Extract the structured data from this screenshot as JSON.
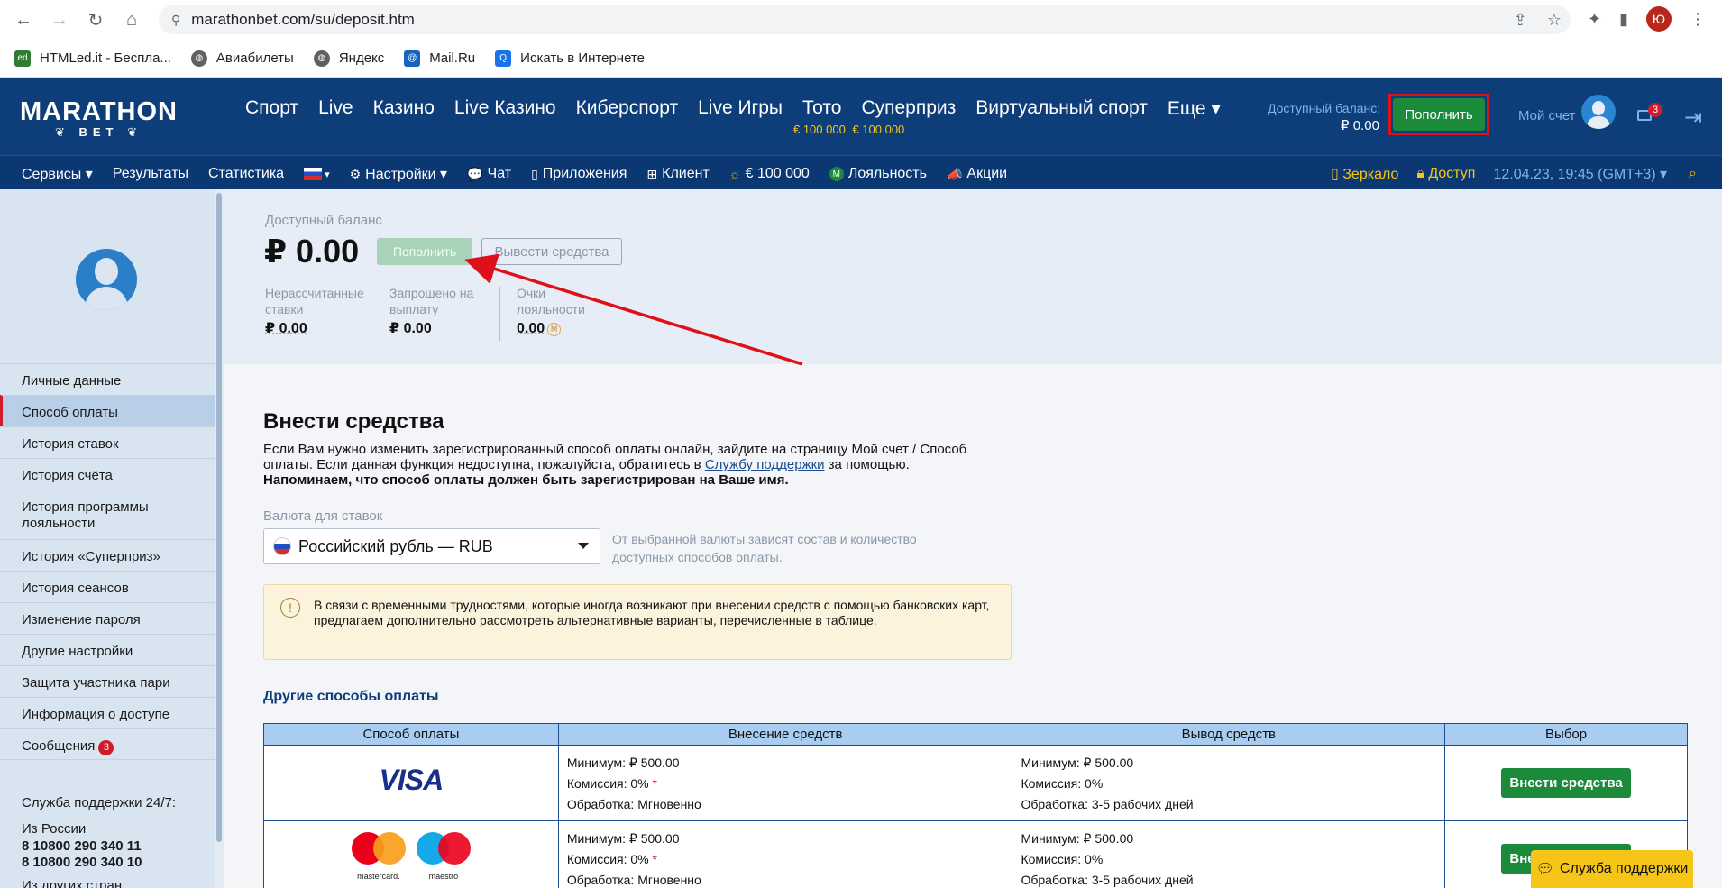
{
  "browser": {
    "url": "marathonbet.com/su/deposit.htm",
    "profile_initial": "Ю",
    "bookmarks": [
      {
        "label": "HTMLed.it - Беспла...",
        "color": "#2e7d32"
      },
      {
        "label": "Авиабилеты",
        "color": "#616161"
      },
      {
        "label": "Яндекс",
        "color": "#616161"
      },
      {
        "label": "Mail.Ru",
        "color": "#1565c0"
      },
      {
        "label": "Искать в Интернете",
        "color": "#1a73e8"
      }
    ]
  },
  "header": {
    "logo_line1": "MARATHON",
    "logo_line2": "BET",
    "nav": [
      {
        "label": "Спорт"
      },
      {
        "label": "Live"
      },
      {
        "label": "Казино"
      },
      {
        "label": "Live Казино"
      },
      {
        "label": "Киберспорт"
      },
      {
        "label": "Live Игры"
      },
      {
        "label": "Тото",
        "sub": "€ 100 000"
      },
      {
        "label": "Суперприз",
        "sub": "€ 100 000"
      },
      {
        "label": "Виртуальный спорт"
      },
      {
        "label": "Еще ▾"
      }
    ],
    "balance_label": "Доступный баланс:",
    "balance_value": "₽ 0.00",
    "deposit_label": "Пополнить",
    "account_label": "Мой счет",
    "mail_count": "3"
  },
  "subnav": {
    "items": [
      {
        "label": "Сервисы ▾"
      },
      {
        "label": "Результаты"
      },
      {
        "label": "Статистика"
      },
      {
        "label": "▾"
      },
      {
        "label": "Настройки ▾",
        "icon": "⚙"
      },
      {
        "label": "Чат",
        "icon": "💬"
      },
      {
        "label": "Приложения",
        "icon": "▯"
      },
      {
        "label": "Клиент",
        "icon": "⊞"
      },
      {
        "label": "€ 100 000",
        "icon": "☼"
      },
      {
        "label": "Лояльность",
        "icon": "M"
      },
      {
        "label": "Акции",
        "icon": "📣"
      }
    ],
    "mirror": "Зеркало",
    "access": "Доступ",
    "datetime": "12.04.23, 19:45 (GMT+3) ▾",
    "search_icon": "⌕"
  },
  "sidebar": {
    "items": [
      {
        "label": "Личные данные"
      },
      {
        "label": "Способ оплаты",
        "active": true
      },
      {
        "label": "История ставок"
      },
      {
        "label": "История счёта"
      },
      {
        "label": "История программы лояльности"
      },
      {
        "label": "История «Суперприз»"
      },
      {
        "label": "История сеансов"
      },
      {
        "label": "Изменение пароля"
      },
      {
        "label": "Другие настройки"
      },
      {
        "label": "Защита участника пари"
      },
      {
        "label": "Информация о доступе"
      },
      {
        "label": "Сообщения",
        "badge": "3"
      }
    ],
    "support_title": "Служба поддержки 24/7:",
    "support_region": "Из России",
    "phone1": "8 10800 290 340 11",
    "phone2": "8 10800 290 340 10",
    "other_countries": "Из других стран"
  },
  "balance_panel": {
    "label": "Доступный баланс",
    "amount": "₽ 0.00",
    "deposit_btn": "Пополнить",
    "withdraw_btn": "Вывести средства",
    "stats": [
      {
        "label": "Нерассчитанные ставки",
        "value": "₽ 0.00"
      },
      {
        "label": "Запрошено на выплату",
        "value": "₽ 0.00"
      },
      {
        "label": "Очки лояльности",
        "value": "0.00"
      }
    ]
  },
  "content": {
    "title": "Внести средства",
    "text1": "Если Вам нужно изменить зарегистрированный способ оплаты онлайн, зайдите на страницу Мой счет / Способ оплаты. Если данная функция недоступна, пожалуйста, обратитесь в ",
    "text_link": "Службу поддержки",
    "text2": " за помощью.",
    "text_bold": "Напоминаем, что способ оплаты должен быть зарегистрирован на Ваше имя.",
    "currency_label": "Валюта для ставок",
    "currency_value": "Российский рубль — RUB",
    "currency_note": "От выбранной валюты зависят состав и количество доступных способов оплаты.",
    "warning": "В связи с временными трудностями, которые иногда возникают при внесении средств с помощью банковских карт, предлагаем дополнительно рассмотреть альтернативные варианты, перечисленные в таблице.",
    "other_methods_title": "Другие способы оплаты",
    "table": {
      "headers": [
        "Способ оплаты",
        "Внесение средств",
        "Вывод средств",
        "Выбор"
      ],
      "rows": [
        {
          "method": "VISA",
          "dep_min": "Минимум: ₽ 500.00",
          "dep_fee": "Комиссия: 0%",
          "dep_fee_mark": "*",
          "dep_proc": "Обработка: Мгновенно",
          "wd_min": "Минимум: ₽ 500.00",
          "wd_fee": "Комиссия: 0%",
          "wd_proc": "Обработка: 3-5 рабочих дней",
          "button": "Внести средства"
        },
        {
          "method": "mastercard / maestro",
          "mc_label": "mastercard.",
          "maestro_label": "maestro",
          "dep_min": "Минимум: ₽ 500.00",
          "dep_fee": "Комиссия: 0%",
          "dep_fee_mark": "*",
          "dep_proc": "Обработка: Мгновенно",
          "wd_min": "Минимум: ₽ 500.00",
          "wd_fee": "Комиссия: 0%",
          "wd_proc": "Обработка: 3-5 рабочих дней",
          "button": "Внести средства"
        }
      ]
    }
  },
  "support_button": "Служба поддержки",
  "colors": {
    "header_bg": "#0d3e7a",
    "accent_green": "#1b8a3b",
    "highlight_red": "#e0101a",
    "gold": "#f5c518"
  }
}
